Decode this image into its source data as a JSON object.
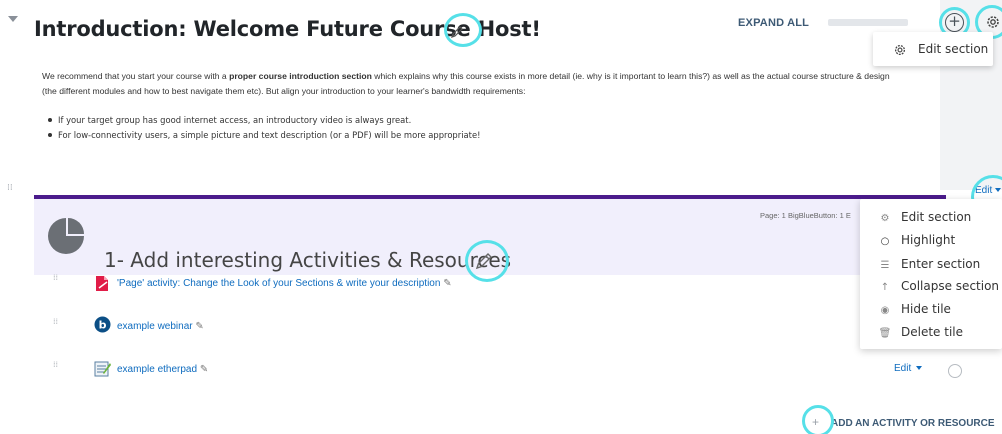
{
  "section": {
    "title": "Introduction: Welcome Future Course Host!",
    "expand_all_label": "EXPAND ALL",
    "progress": 0,
    "add_icon": "plus-circle-icon",
    "settings_icon": "gear-icon",
    "mini_menu": {
      "edit_label": "Edit section"
    },
    "intro": {
      "p_a": "We recommend that you start your course with a ",
      "p_bold": "proper course introduction section",
      "p_b": " which explains why this course exists in more detail (ie. why is it important to learn this?) as well as the actual course structure & design",
      "p_line2": "(the different modules and how to best navigate them etc). But align your introduction to your learner's bandwidth requirements:",
      "bullets": [
        "If your target group has good internet access, an introductory video is always great.",
        "For low-connectivity users, a simple picture and text description (or a PDF) will be more appropriate!"
      ]
    }
  },
  "tile": {
    "edit_label": "Edit",
    "title": "1- Add interesting Activities & Resources",
    "meta": "Page: 1 BigBlueButton: 1 E",
    "menu": [
      {
        "label": "Edit section",
        "icon": "gear-icon"
      },
      {
        "label": "Highlight",
        "icon": "circle-icon"
      },
      {
        "label": "Enter section",
        "icon": "list-icon"
      },
      {
        "label": "Collapse section",
        "icon": "arrow-up-icon"
      },
      {
        "label": "Hide tile",
        "icon": "eye-icon"
      },
      {
        "label": "Delete tile",
        "icon": "trash-icon"
      }
    ],
    "activities": [
      {
        "label": "'Page' activity: Change the Look of your Sections & write your description",
        "icon": "page-icon"
      },
      {
        "label": "example webinar",
        "icon": "bigbluebutton-icon"
      },
      {
        "label": "example etherpad",
        "icon": "etherpad-icon"
      }
    ],
    "activity_edit_label": "Edit",
    "add_activity_label": "ADD AN ACTIVITY OR RESOURCE"
  },
  "colors": {
    "accent_purple": "#4b1b8c",
    "link_blue": "#0f6cbf",
    "highlight_ring": "#56e0e8",
    "tile_band": "#f1effc"
  }
}
